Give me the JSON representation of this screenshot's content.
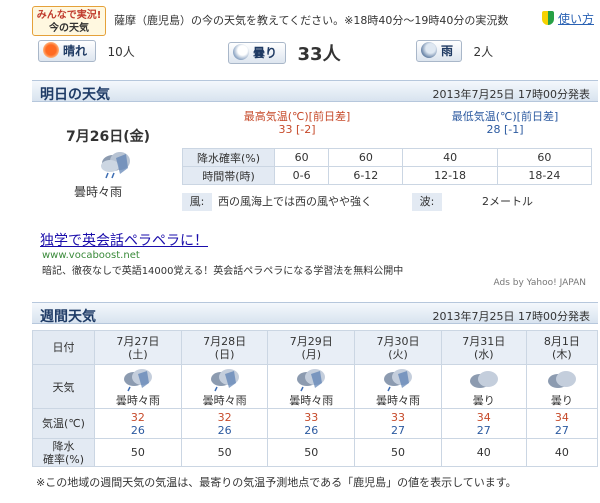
{
  "jikkyo": {
    "logo_line1": "みんなで実況!",
    "logo_line2": "今の天気",
    "text": "薩摩（鹿児島）の今の天気を教えてください。※18時40分～19時40分の実況数",
    "help_label": "使い方",
    "votes": [
      {
        "label": "晴れ",
        "count": "10人",
        "icon": "sun-icon"
      },
      {
        "label": "曇り",
        "count": "33人",
        "icon": "cloud-icon"
      },
      {
        "label": "雨",
        "count": "2人",
        "icon": "umbrella-icon"
      }
    ]
  },
  "tomorrow": {
    "section_title": "明日の天気",
    "announce": "2013年7月25日 17時00分発表",
    "date": "7月26日(金)",
    "telop": "曇時々雨",
    "icon": "cloud-rain-icon",
    "max_label": "最高気温(℃)[前日差]",
    "max_value": "33 [-2]",
    "min_label": "最低気温(℃)[前日差]",
    "min_value": "28 [-1]",
    "rain_label": "降水確率(%)",
    "rain_values": [
      "60",
      "60",
      "40",
      "60"
    ],
    "period_label": "時間帯(時)",
    "periods": [
      "0-6",
      "6-12",
      "12-18",
      "18-24"
    ],
    "wind_label": "風:",
    "wind_value": "西の風海上では西の風やや強く",
    "wave_label": "波:",
    "wave_value": "2メートル"
  },
  "ad": {
    "title": "独学で英会話ペラペラに！",
    "url": "www.vocaboost.net",
    "desc": "暗記、徹夜なしで英語14000覚える！英会話ペラペラになる学習法を無料公開中",
    "by": "Ads by Yahoo! JAPAN"
  },
  "weekly": {
    "section_title": "週間天気",
    "announce": "2013年7月25日 17時00分発表",
    "row_labels": {
      "date": "日付",
      "weather": "天気",
      "temp": "気温(℃)",
      "prob_line1": "降水",
      "prob_line2": "確率(%)"
    },
    "days": [
      {
        "date": "7月27日",
        "dow": "(土)",
        "weather": "曇時々雨",
        "icon": "cloud-rain-icon",
        "hi": "32",
        "lo": "26",
        "prob": "50"
      },
      {
        "date": "7月28日",
        "dow": "(日)",
        "weather": "曇時々雨",
        "icon": "cloud-rain-icon",
        "hi": "32",
        "lo": "26",
        "prob": "50"
      },
      {
        "date": "7月29日",
        "dow": "(月)",
        "weather": "曇時々雨",
        "icon": "cloud-rain-icon",
        "hi": "33",
        "lo": "26",
        "prob": "50"
      },
      {
        "date": "7月30日",
        "dow": "(火)",
        "weather": "曇時々雨",
        "icon": "cloud-rain-icon",
        "hi": "33",
        "lo": "27",
        "prob": "50"
      },
      {
        "date": "7月31日",
        "dow": "(水)",
        "weather": "曇り",
        "icon": "cloud-icon",
        "hi": "34",
        "lo": "27",
        "prob": "40"
      },
      {
        "date": "8月1日",
        "dow": "(木)",
        "weather": "曇り",
        "icon": "cloud-icon",
        "hi": "34",
        "lo": "27",
        "prob": "40"
      }
    ]
  },
  "note": "※この地域の週間天気の気温は、最寄りの気温予測地点である「鹿児島」の値を表示しています。",
  "colors": {
    "accent": "#1e3b66",
    "hi_temp": "#c64a2a",
    "lo_temp": "#2c5aa0",
    "header_bg": "#d8e3ef"
  }
}
